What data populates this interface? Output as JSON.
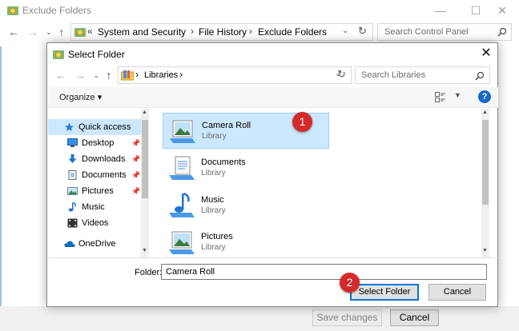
{
  "parent_window": {
    "title": "Exclude Folders",
    "controls": [
      "—",
      "☐",
      "✕"
    ],
    "breadcrumb": [
      "System and Security",
      "File History",
      "Exclude Folders"
    ],
    "search_placeholder": "Search Control Panel",
    "save_label": "Save changes",
    "cancel_label": "Cancel"
  },
  "dialog": {
    "title": "Select Folder",
    "breadcrumb": [
      "Libraries"
    ],
    "search_placeholder": "Search Libraries",
    "organize_label": "Organize",
    "nav": {
      "quick_access": "Quick access",
      "items": [
        {
          "label": "Desktop",
          "icon": "desktop-icon",
          "pinned": true
        },
        {
          "label": "Downloads",
          "icon": "downloads-icon",
          "pinned": true
        },
        {
          "label": "Documents",
          "icon": "documents-icon",
          "pinned": true
        },
        {
          "label": "Pictures",
          "icon": "pictures-icon",
          "pinned": true
        },
        {
          "label": "Music",
          "icon": "music-icon",
          "pinned": false
        },
        {
          "label": "Videos",
          "icon": "videos-icon",
          "pinned": false
        }
      ],
      "onedrive": "OneDrive"
    },
    "files": [
      {
        "name": "Camera Roll",
        "type": "Library",
        "selected": true
      },
      {
        "name": "Documents",
        "type": "Library",
        "selected": false
      },
      {
        "name": "Music",
        "type": "Library",
        "selected": false
      },
      {
        "name": "Pictures",
        "type": "Library",
        "selected": false
      }
    ],
    "folder_label": "Folder:",
    "folder_value": "Camera Roll",
    "select_label": "Select Folder",
    "cancel_label": "Cancel"
  },
  "annotations": {
    "badge1": "1",
    "badge2": "2"
  },
  "colors": {
    "selection": "#cce8ff",
    "accent": "#0078d7",
    "badge": "#d42a2a"
  }
}
